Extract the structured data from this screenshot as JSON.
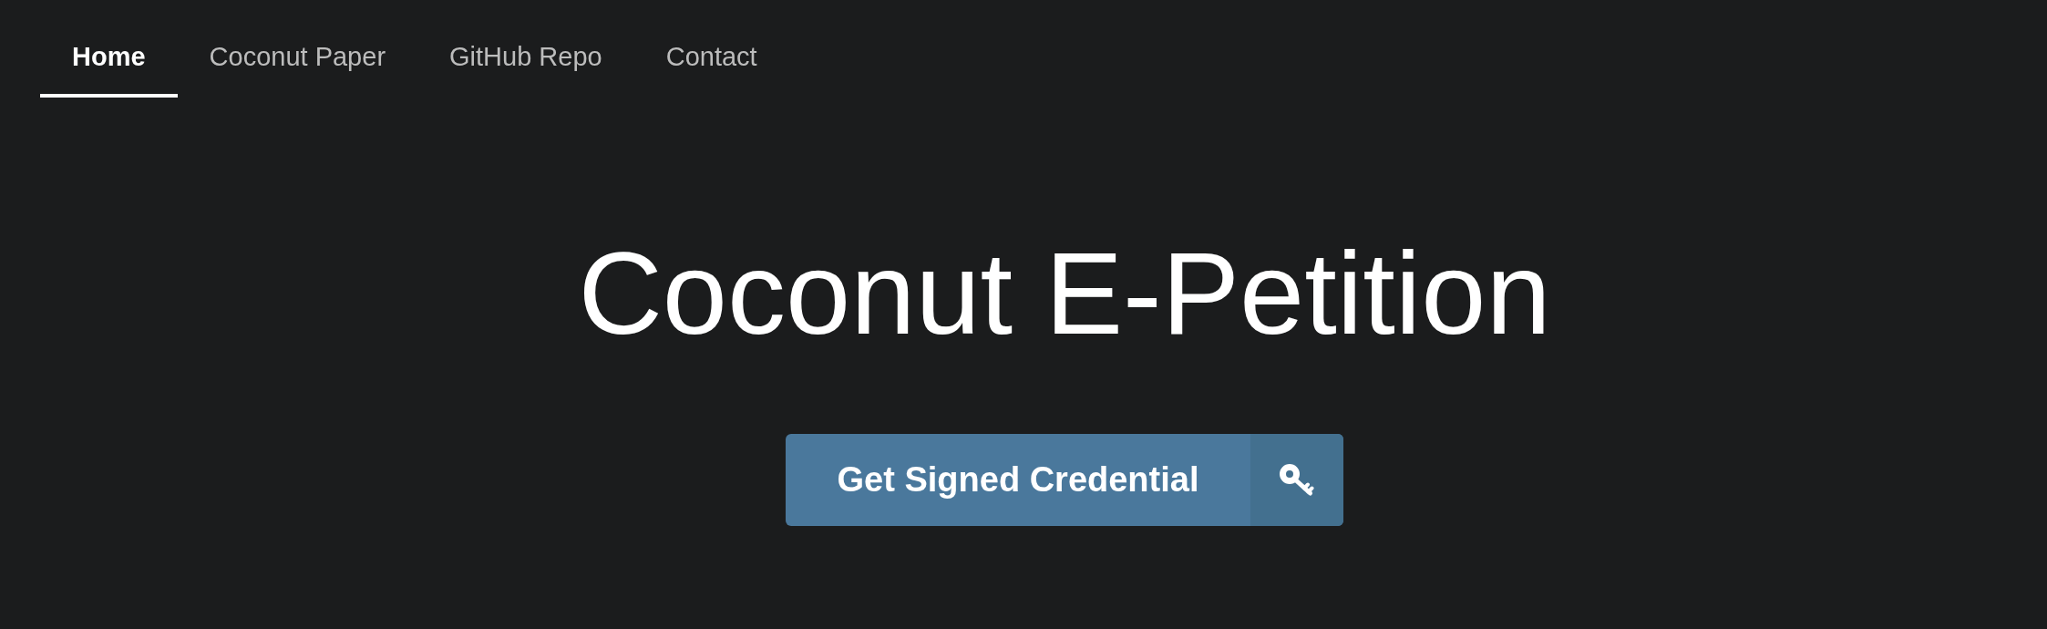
{
  "nav": {
    "tabs": [
      {
        "label": "Home",
        "selected": true
      },
      {
        "label": "Coconut Paper",
        "selected": false
      },
      {
        "label": "GitHub Repo",
        "selected": false
      },
      {
        "label": "Contact",
        "selected": false
      }
    ]
  },
  "hero": {
    "title": "Coconut E-Petition",
    "button": {
      "label": "Get Signed Credential"
    }
  }
}
